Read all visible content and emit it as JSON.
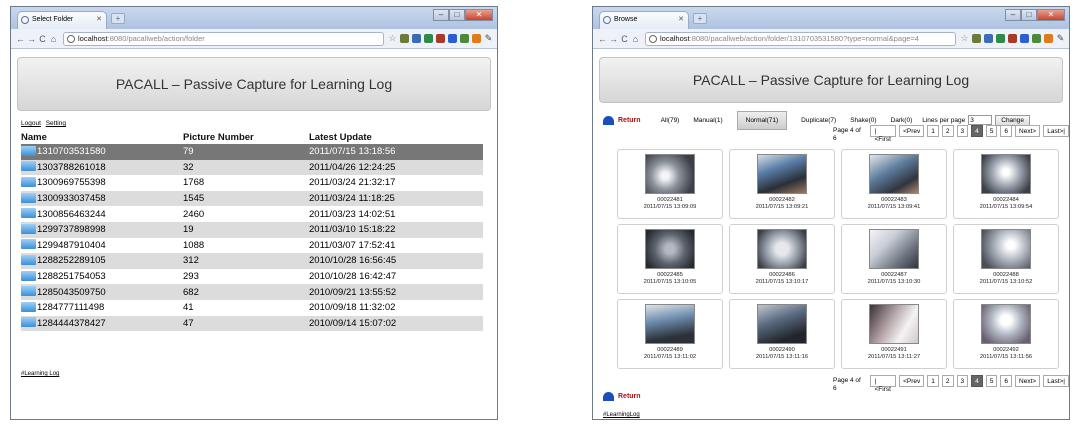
{
  "left_window": {
    "tab_title": "Select Folder",
    "url_host": "localhost",
    "url_rest": ":8080/pacallweb/action/folder",
    "header_title": "PACALL – Passive Capture for Learning Log",
    "links": {
      "logout": "Logout",
      "setting": "Setting"
    },
    "columns": [
      "Name",
      "Picture Number",
      "Latest Update"
    ],
    "rows": [
      {
        "name": "1310703531580",
        "count": "79",
        "updated": "2011/07/15 13:18:56"
      },
      {
        "name": "1303788261018",
        "count": "32",
        "updated": "2011/04/26 12:24:25"
      },
      {
        "name": "1300969755398",
        "count": "1768",
        "updated": "2011/03/24 21:32:17"
      },
      {
        "name": "1300933037458",
        "count": "1545",
        "updated": "2011/03/24 11:18:25"
      },
      {
        "name": "1300856463244",
        "count": "2460",
        "updated": "2011/03/23 14:02:51"
      },
      {
        "name": "1299737898998",
        "count": "19",
        "updated": "2011/03/10 15:18:22"
      },
      {
        "name": "1299487910404",
        "count": "1088",
        "updated": "2011/03/07 17:52:41"
      },
      {
        "name": "1288252289105",
        "count": "312",
        "updated": "2010/10/28 16:56:45"
      },
      {
        "name": "1288251754053",
        "count": "293",
        "updated": "2010/10/28 16:42:47"
      },
      {
        "name": "1285043509750",
        "count": "682",
        "updated": "2010/09/21 13:55:52"
      },
      {
        "name": "1284777111498",
        "count": "41",
        "updated": "2010/09/18 11:32:02"
      },
      {
        "name": "1284444378427",
        "count": "47",
        "updated": "2010/09/14 15:07:02"
      }
    ],
    "footer": "#Learning Log"
  },
  "right_window": {
    "tab_title": "Browse",
    "url_host": "localhost",
    "url_rest": ":8080/pacallweb/action/folder/1310703531580?type=normal&page=4",
    "header_title": "PACALL – Passive Capture for Learning Log",
    "return_label": "Return",
    "filters": [
      "All(79)",
      "Manual(1)",
      "Normal(71)",
      "Duplicate(7)",
      "Shake(0)",
      "Dark(0)"
    ],
    "active_filter": "Normal(71)",
    "lines_per_page_label": "Lines per page",
    "lines_per_page_value": "3",
    "change_button": "Change",
    "pager": {
      "info": "Page 4 of 6",
      "first": "|<First",
      "prev": "<Prev",
      "pages": [
        "1",
        "2",
        "3",
        "4",
        "5",
        "6"
      ],
      "current": "4",
      "next": "Next>",
      "last": "Last>|"
    },
    "photos": [
      {
        "id": "00022481",
        "time": "2011/07/15 13:09:09"
      },
      {
        "id": "00022482",
        "time": "2011/07/15 13:09:21"
      },
      {
        "id": "00022483",
        "time": "2011/07/15 13:09:41"
      },
      {
        "id": "00022484",
        "time": "2011/07/15 13:09:54"
      },
      {
        "id": "00022485",
        "time": "2011/07/15 13:10:05"
      },
      {
        "id": "00022486",
        "time": "2011/07/15 13:10:17"
      },
      {
        "id": "00022487",
        "time": "2011/07/15 13:10:30"
      },
      {
        "id": "00022488",
        "time": "2011/07/15 13:10:52"
      },
      {
        "id": "00022489",
        "time": "2011/07/15 13:11:02"
      },
      {
        "id": "00022490",
        "time": "2011/07/15 13:11:16"
      },
      {
        "id": "00022491",
        "time": "2011/07/15 13:11:27"
      },
      {
        "id": "00022492",
        "time": "2011/07/15 13:11:56"
      }
    ],
    "footer": "#LearningLog"
  }
}
